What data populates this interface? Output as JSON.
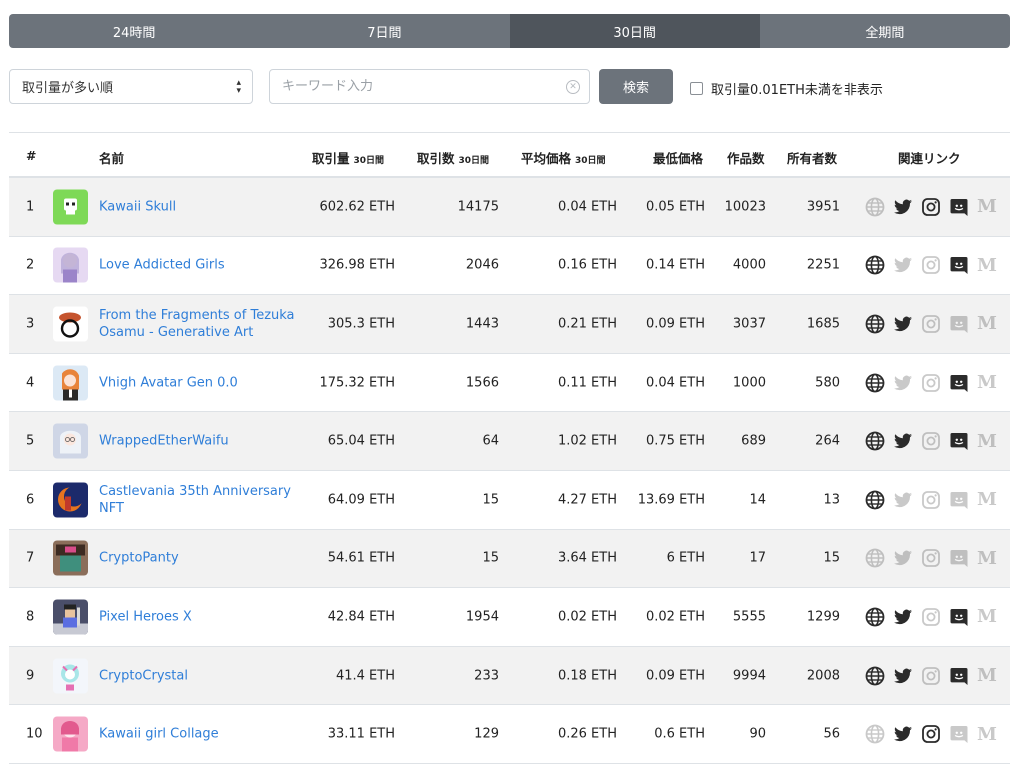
{
  "tabs": [
    {
      "label": "24時間",
      "active": false
    },
    {
      "label": "7日間",
      "active": false
    },
    {
      "label": "30日間",
      "active": true
    },
    {
      "label": "全期間",
      "active": false
    }
  ],
  "toolbar": {
    "sort_value": "取引量が多い順",
    "search_placeholder": "キーワード入力",
    "search_button": "検索",
    "filter_label": "取引量0.01ETH未満を非表示"
  },
  "table": {
    "headers": {
      "rank": "#",
      "name": "名前",
      "volume": "取引量",
      "volume_period": "30日間",
      "count": "取引数",
      "count_period": "30日間",
      "avg": "平均価格",
      "avg_period": "30日間",
      "floor": "最低価格",
      "items": "作品数",
      "owners": "所有者数",
      "links": "関連リンク"
    },
    "rows": [
      {
        "rank": "1",
        "name": "Kawaii Skull",
        "volume": "602.62 ETH",
        "count": "14175",
        "avg": "0.04 ETH",
        "floor": "0.05 ETH",
        "items": "10023",
        "owners": "3951",
        "links": {
          "web": false,
          "twitter": true,
          "instagram": true,
          "discord": true,
          "medium": false
        },
        "thumb_color": "#7ed957"
      },
      {
        "rank": "2",
        "name": "Love Addicted Girls",
        "volume": "326.98 ETH",
        "count": "2046",
        "avg": "0.16 ETH",
        "floor": "0.14 ETH",
        "items": "4000",
        "owners": "2251",
        "links": {
          "web": true,
          "twitter": false,
          "instagram": false,
          "discord": true,
          "medium": false
        },
        "thumb_color": "#e6d9f2"
      },
      {
        "rank": "3",
        "name": "From the Fragments of Tezuka Osamu - Generative Art",
        "volume": "305.3 ETH",
        "count": "1443",
        "avg": "0.21 ETH",
        "floor": "0.09 ETH",
        "items": "3037",
        "owners": "1685",
        "links": {
          "web": true,
          "twitter": true,
          "instagram": false,
          "discord": false,
          "medium": false
        },
        "thumb_color": "#ffffff"
      },
      {
        "rank": "4",
        "name": "Vhigh Avatar Gen 0.0",
        "volume": "175.32 ETH",
        "count": "1566",
        "avg": "0.11 ETH",
        "floor": "0.04 ETH",
        "items": "1000",
        "owners": "580",
        "links": {
          "web": true,
          "twitter": false,
          "instagram": false,
          "discord": true,
          "medium": false
        },
        "thumb_color": "#dce9f5"
      },
      {
        "rank": "5",
        "name": "WrappedEtherWaifu",
        "volume": "65.04 ETH",
        "count": "64",
        "avg": "1.02 ETH",
        "floor": "0.75 ETH",
        "items": "689",
        "owners": "264",
        "links": {
          "web": true,
          "twitter": true,
          "instagram": false,
          "discord": true,
          "medium": false
        },
        "thumb_color": "#cfd6e6"
      },
      {
        "rank": "6",
        "name": "Castlevania 35th Anniversary NFT",
        "volume": "64.09 ETH",
        "count": "15",
        "avg": "4.27 ETH",
        "floor": "13.69 ETH",
        "items": "14",
        "owners": "13",
        "links": {
          "web": true,
          "twitter": false,
          "instagram": false,
          "discord": false,
          "medium": false
        },
        "thumb_color": "#c0392b"
      },
      {
        "rank": "7",
        "name": "CryptoPanty",
        "volume": "54.61 ETH",
        "count": "15",
        "avg": "3.64 ETH",
        "floor": "6 ETH",
        "items": "17",
        "owners": "15",
        "links": {
          "web": false,
          "twitter": false,
          "instagram": false,
          "discord": false,
          "medium": false
        },
        "thumb_color": "#8b6e5a"
      },
      {
        "rank": "8",
        "name": "Pixel Heroes X",
        "volume": "42.84 ETH",
        "count": "1954",
        "avg": "0.02 ETH",
        "floor": "0.02 ETH",
        "items": "5555",
        "owners": "1299",
        "links": {
          "web": true,
          "twitter": true,
          "instagram": false,
          "discord": true,
          "medium": false
        },
        "thumb_color": "#4a4e69"
      },
      {
        "rank": "9",
        "name": "CryptoCrystal",
        "volume": "41.4 ETH",
        "count": "233",
        "avg": "0.18 ETH",
        "floor": "0.09 ETH",
        "items": "9994",
        "owners": "2008",
        "links": {
          "web": true,
          "twitter": true,
          "instagram": false,
          "discord": true,
          "medium": false
        },
        "thumb_color": "#f3f6fb"
      },
      {
        "rank": "10",
        "name": "Kawaii girl Collage",
        "volume": "33.11 ETH",
        "count": "129",
        "avg": "0.26 ETH",
        "floor": "0.6 ETH",
        "items": "90",
        "owners": "56",
        "links": {
          "web": false,
          "twitter": true,
          "instagram": true,
          "discord": false,
          "medium": false
        },
        "thumb_color": "#f5a9c6"
      }
    ]
  }
}
